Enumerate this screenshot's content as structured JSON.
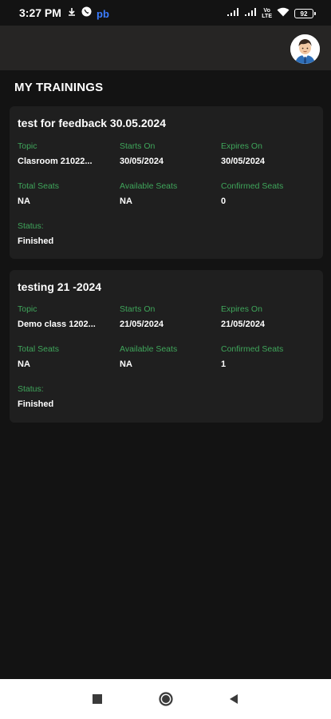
{
  "status_bar": {
    "time": "3:27 PM",
    "carrier_badge": "pb",
    "volte": [
      "Vo",
      "LTE"
    ],
    "battery": "92"
  },
  "header": {
    "avatar_icon": "user-avatar-icon"
  },
  "page": {
    "title": "MY TRAININGS"
  },
  "labels": {
    "topic": "Topic",
    "starts_on": "Starts On",
    "expires_on": "Expires On",
    "total_seats": "Total Seats",
    "available_seats": "Available Seats",
    "confirmed_seats": "Confirmed Seats",
    "status": "Status:"
  },
  "trainings": [
    {
      "title": "test for feedback 30.05.2024",
      "topic": "Clasroom 21022...",
      "starts_on": "30/05/2024",
      "expires_on": "30/05/2024",
      "total_seats": "NA",
      "available_seats": "NA",
      "confirmed_seats": "0",
      "status": "Finished"
    },
    {
      "title": "testing 21 -2024",
      "topic": "Demo class 1202...",
      "starts_on": "21/05/2024",
      "expires_on": "21/05/2024",
      "total_seats": "NA",
      "available_seats": "NA",
      "confirmed_seats": "1",
      "status": "Finished"
    }
  ],
  "nav": {
    "recents_icon": "square-icon",
    "home_icon": "circle-icon",
    "back_icon": "triangle-back-icon"
  },
  "colors": {
    "background": "#131313",
    "app_bar": "#262524",
    "card": "#1f1f1f",
    "label_green": "#3fa65b"
  }
}
